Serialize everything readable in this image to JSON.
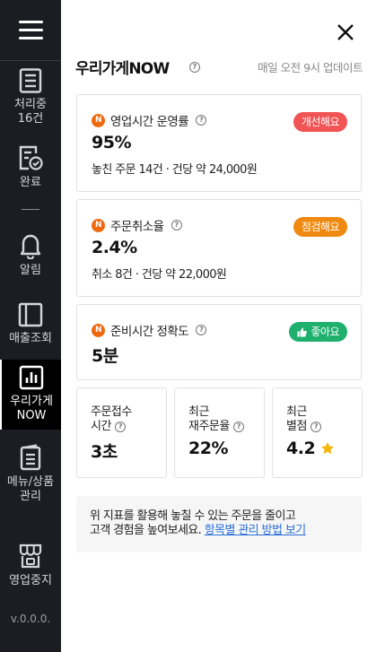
{
  "sidebar": {
    "menu_icon": "hamburger-icon",
    "items": [
      {
        "label_line1": "처리중",
        "label_line2": "16건",
        "icon": "list-document-icon"
      },
      {
        "label_line1": "완료",
        "label_line2": "",
        "icon": "checked-document-icon"
      },
      {
        "label_line1": "알림",
        "label_line2": "",
        "icon": "bell-icon"
      },
      {
        "label_line1": "매출조회",
        "label_line2": "",
        "icon": "ledger-icon"
      },
      {
        "label_line1": "우리가게",
        "label_line2": "NOW",
        "icon": "bar-chart-icon"
      },
      {
        "label_line1": "메뉴/상품",
        "label_line2": "관리",
        "icon": "menu-list-icon"
      },
      {
        "label_line1": "영업중지",
        "label_line2": "",
        "icon": "store-closed-icon"
      }
    ],
    "version": "v.0.0.0."
  },
  "header": {
    "title": "우리가게NOW",
    "note": "매일 오전 9시 업데이트",
    "help_glyph": "?"
  },
  "cards": [
    {
      "badge_letter": "N",
      "title": "영업시간 운영률",
      "value": "95%",
      "sub": "놓친 주문 14건 · 건당 약 24,000원",
      "status": "개선해요",
      "status_color": "#f05454"
    },
    {
      "badge_letter": "N",
      "title": "주문취소율",
      "value": "2.4%",
      "sub": "취소 8건 · 건당 약 22,000원",
      "status": "점검해요",
      "status_color": "#f0890f"
    },
    {
      "badge_letter": "N",
      "title": "준비시간 정확도",
      "value": "5분",
      "sub": "",
      "status": "좋아요",
      "status_color": "#1fb06e"
    }
  ],
  "mini_cards": [
    {
      "line1": "주문접수",
      "line2": "시간",
      "value": "3초"
    },
    {
      "line1": "최근",
      "line2": "재주문율",
      "value": "22%"
    },
    {
      "line1": "최근",
      "line2": "별점",
      "value": "4.2",
      "icon": "star-icon",
      "icon_color": "#f5b400"
    }
  ],
  "notice": {
    "line1": "위 지표를 활용해 놓칠 수 있는 주문을 줄이고",
    "line2": "고객 경험을 높여보세요.",
    "link": "항목별 관리 방법 보기"
  },
  "colors": {
    "sidebar_bg": "#1b1d22",
    "accent_orange": "#ef6a0f",
    "link": "#2a6fd8"
  }
}
